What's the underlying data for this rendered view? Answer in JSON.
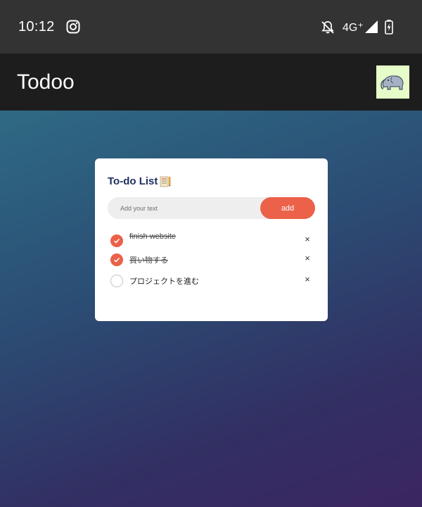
{
  "status_bar": {
    "time": "10:12",
    "network": "4G⁺",
    "icons": [
      "instagram-icon",
      "notifications-off-icon",
      "signal-icon",
      "battery-charging-icon"
    ]
  },
  "app_bar": {
    "title": "Todoo",
    "avatar_icon": "elephant-icon",
    "avatar_bg": "#e7fdc9"
  },
  "card": {
    "title": "To-do List",
    "title_icon": "notepad-icon",
    "input_placeholder": "Add your text",
    "input_value": "",
    "add_label": "add",
    "accent": "#eb6149",
    "items": [
      {
        "label": "finish website",
        "done": true,
        "delete": "×"
      },
      {
        "label": "買い物する",
        "done": true,
        "delete": "×"
      },
      {
        "label": "プロジェクトを進む",
        "done": false,
        "delete": "×"
      }
    ]
  }
}
